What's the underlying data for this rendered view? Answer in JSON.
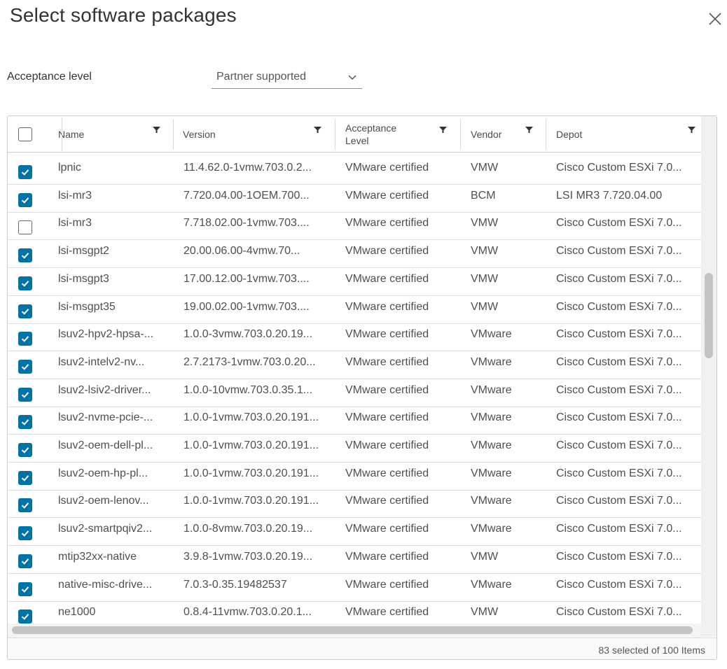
{
  "dialog": {
    "title": "Select software packages",
    "acceptance_label": "Acceptance level",
    "acceptance_value": "Partner supported"
  },
  "colors": {
    "accent": "#0072a3",
    "border": "#cccccc",
    "text": "#4f4f4f"
  },
  "table": {
    "columns": [
      {
        "label": "Name",
        "label2": ""
      },
      {
        "label": "Version",
        "label2": ""
      },
      {
        "label": "Acceptance",
        "label2": "Level"
      },
      {
        "label": "Vendor",
        "label2": ""
      },
      {
        "label": "Depot",
        "label2": ""
      }
    ],
    "rows": [
      {
        "checked": true,
        "name": "lpnic",
        "version": "11.4.62.0-1vmw.703.0.2...",
        "acceptance": "VMware certified",
        "vendor": "VMW",
        "depot": "Cisco Custom ESXi 7.0..."
      },
      {
        "checked": true,
        "name": "lsi-mr3",
        "version": "7.720.04.00-1OEM.700...",
        "acceptance": "VMware certified",
        "vendor": "BCM",
        "depot": "LSI MR3 7.720.04.00"
      },
      {
        "checked": false,
        "name": "lsi-mr3",
        "version": "7.718.02.00-1vmw.703....",
        "acceptance": "VMware certified",
        "vendor": "VMW",
        "depot": "Cisco Custom ESXi 7.0..."
      },
      {
        "checked": true,
        "name": "lsi-msgpt2",
        "version": "20.00.06.00-4vmw.70...",
        "acceptance": "VMware certified",
        "vendor": "VMW",
        "depot": "Cisco Custom ESXi 7.0..."
      },
      {
        "checked": true,
        "name": "lsi-msgpt3",
        "version": "17.00.12.00-1vmw.703....",
        "acceptance": "VMware certified",
        "vendor": "VMW",
        "depot": "Cisco Custom ESXi 7.0..."
      },
      {
        "checked": true,
        "name": "lsi-msgpt35",
        "version": "19.00.02.00-1vmw.703....",
        "acceptance": "VMware certified",
        "vendor": "VMW",
        "depot": "Cisco Custom ESXi 7.0..."
      },
      {
        "checked": true,
        "name": "lsuv2-hpv2-hpsa-...",
        "version": "1.0.0-3vmw.703.0.20.19...",
        "acceptance": "VMware certified",
        "vendor": "VMware",
        "depot": "Cisco Custom ESXi 7.0..."
      },
      {
        "checked": true,
        "name": "lsuv2-intelv2-nv...",
        "version": "2.7.2173-1vmw.703.0.20...",
        "acceptance": "VMware certified",
        "vendor": "VMware",
        "depot": "Cisco Custom ESXi 7.0..."
      },
      {
        "checked": true,
        "name": "lsuv2-lsiv2-driver...",
        "version": "1.0.0-10vmw.703.0.35.1...",
        "acceptance": "VMware certified",
        "vendor": "VMware",
        "depot": "Cisco Custom ESXi 7.0..."
      },
      {
        "checked": true,
        "name": "lsuv2-nvme-pcie-...",
        "version": "1.0.0-1vmw.703.0.20.191...",
        "acceptance": "VMware certified",
        "vendor": "VMware",
        "depot": "Cisco Custom ESXi 7.0..."
      },
      {
        "checked": true,
        "name": "lsuv2-oem-dell-pl...",
        "version": "1.0.0-1vmw.703.0.20.191...",
        "acceptance": "VMware certified",
        "vendor": "VMware",
        "depot": "Cisco Custom ESXi 7.0..."
      },
      {
        "checked": true,
        "name": "lsuv2-oem-hp-pl...",
        "version": "1.0.0-1vmw.703.0.20.191...",
        "acceptance": "VMware certified",
        "vendor": "VMware",
        "depot": "Cisco Custom ESXi 7.0..."
      },
      {
        "checked": true,
        "name": "lsuv2-oem-lenov...",
        "version": "1.0.0-1vmw.703.0.20.191...",
        "acceptance": "VMware certified",
        "vendor": "VMware",
        "depot": "Cisco Custom ESXi 7.0..."
      },
      {
        "checked": true,
        "name": "lsuv2-smartpqiv2...",
        "version": "1.0.0-8vmw.703.0.20.19...",
        "acceptance": "VMware certified",
        "vendor": "VMware",
        "depot": "Cisco Custom ESXi 7.0..."
      },
      {
        "checked": true,
        "name": "mtip32xx-native",
        "version": "3.9.8-1vmw.703.0.20.19...",
        "acceptance": "VMware certified",
        "vendor": "VMW",
        "depot": "Cisco Custom ESXi 7.0..."
      },
      {
        "checked": true,
        "name": "native-misc-drive...",
        "version": "7.0.3-0.35.19482537",
        "acceptance": "VMware certified",
        "vendor": "VMware",
        "depot": "Cisco Custom ESXi 7.0..."
      },
      {
        "checked": true,
        "name": "ne1000",
        "version": "0.8.4-11vmw.703.0.20.1...",
        "acceptance": "VMware certified",
        "vendor": "VMW",
        "depot": "Cisco Custom ESXi 7.0..."
      }
    ],
    "footer": "83 selected of 100 Items"
  }
}
